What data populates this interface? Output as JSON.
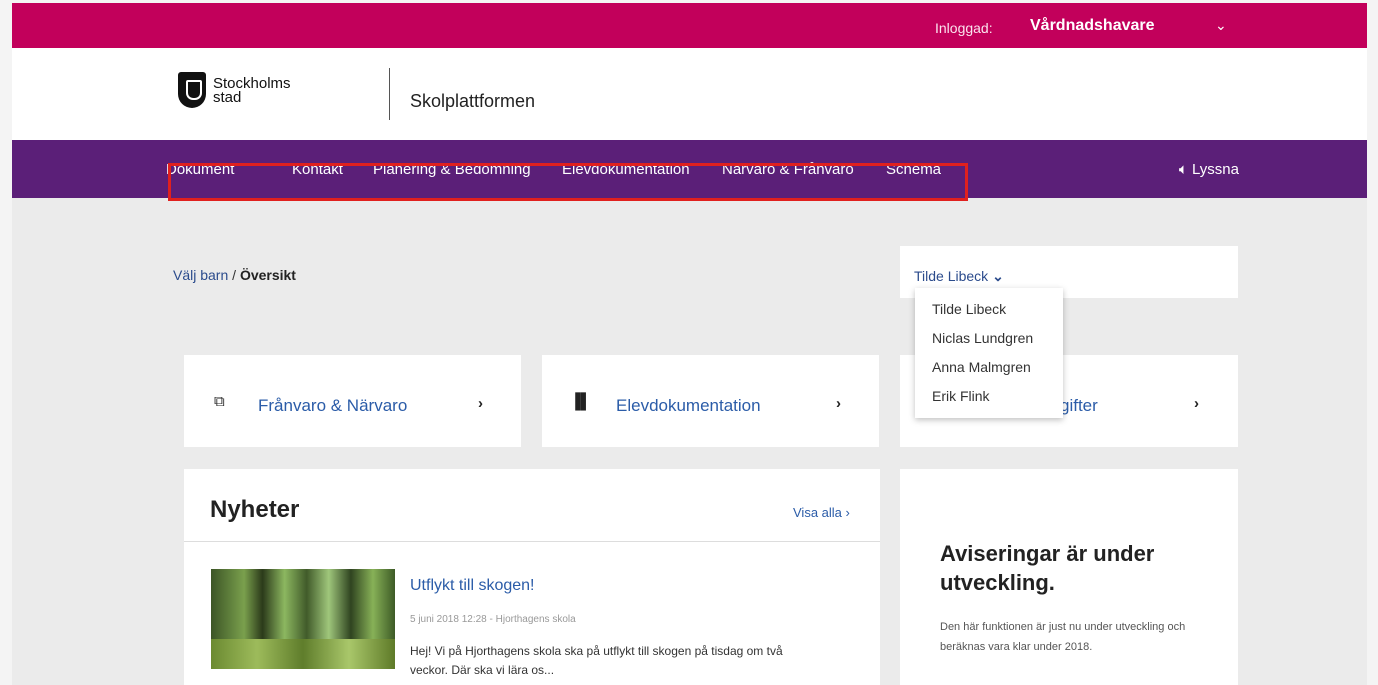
{
  "topbar": {
    "logged_in_label": "Inloggad:",
    "role": "Vårdnadshavare",
    "chevron": "⌄"
  },
  "header": {
    "logo_line1": "Stockholms",
    "logo_line2": "stad",
    "platform": "Skolplattformen"
  },
  "nav": {
    "items": [
      "Dokument",
      "Kontakt",
      "Planering & Bedömning",
      "Elevdokumentation",
      "Närvaro & Frånvaro",
      "Schema"
    ],
    "listen_label": "Lyssna",
    "highlight_color": "#e0201e"
  },
  "breadcrumb": {
    "link": "Välj barn",
    "separator": " / ",
    "current": "Översikt"
  },
  "child_selector": {
    "selected": "Tilde Libeck",
    "options": [
      "Tilde Libeck",
      "Niclas Lundgren",
      "Anna Malmgren",
      "Erik Flink"
    ]
  },
  "cards": [
    {
      "icon": "calendar-icon",
      "label": "Frånvaro & Närvaro"
    },
    {
      "icon": "book-icon",
      "label": "Elevdokumentation"
    },
    {
      "icon": "tasks-icon",
      "label": "Läxor & Uppgifter",
      "visible_label": "gifter"
    }
  ],
  "news": {
    "heading": "Nyheter",
    "view_all": "Visa alla ›",
    "item": {
      "title": "Utflykt till skogen!",
      "meta": "5 juni 2018 12:28 - Hjorthagens skola",
      "body": "Hej! Vi på Hjorthagens skola ska på utflykt till skogen på tisdag om två veckor. Där ska vi lära os..."
    }
  },
  "notice": {
    "heading": "Aviseringar är under utveckling.",
    "text": "Den här funktionen är just nu under utveckling och beräknas vara klar under 2018."
  },
  "colors": {
    "topbar": "#c2005b",
    "nav": "#5b1f78",
    "link": "#2b5ca8"
  }
}
